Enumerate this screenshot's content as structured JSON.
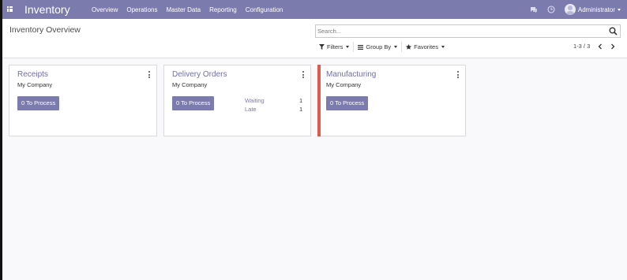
{
  "navbar": {
    "app_title": "Inventory",
    "menu": [
      "Overview",
      "Operations",
      "Master Data",
      "Reporting",
      "Configuration"
    ],
    "user_name": "Administrator"
  },
  "control_panel": {
    "title": "Inventory Overview",
    "search_placeholder": "Search...",
    "filters_label": "Filters",
    "group_by_label": "Group By",
    "favorites_label": "Favorites",
    "pager_text": "1-3 / 3"
  },
  "cards": [
    {
      "title": "Receipts",
      "company": "My Company",
      "button_label": "0 To Process"
    },
    {
      "title": "Delivery Orders",
      "company": "My Company",
      "button_label": "0 To Process",
      "stats": [
        {
          "label": "Waiting",
          "value": "1"
        },
        {
          "label": "Late",
          "value": "1"
        }
      ]
    },
    {
      "title": "Manufacturing",
      "company": "My Company",
      "button_label": "0 To Process"
    }
  ],
  "colors": {
    "primary": "#7c7bad",
    "card_stripe": "#e05a4f",
    "background": "#f9f9fb"
  },
  "icons": {
    "apps": "apps-grid-icon",
    "chat": "chat-icon",
    "activity": "clock-icon",
    "search": "search-icon",
    "filter": "filter-icon",
    "group_by": "bars-icon",
    "favorites": "star-icon",
    "pager_prev": "chevron-left-icon",
    "pager_next": "chevron-right-icon",
    "card_menu": "vertical-dots-icon"
  }
}
